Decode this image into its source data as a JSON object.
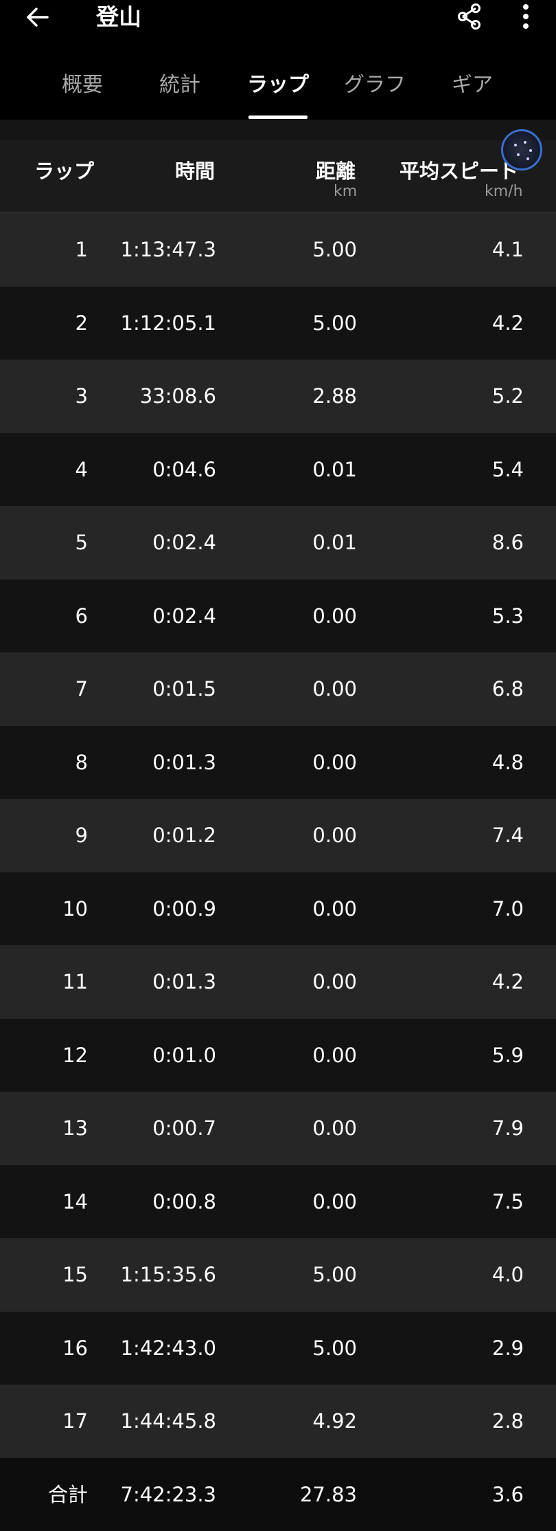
{
  "header": {
    "title": "登山",
    "icons": {
      "back": "arrow-left-icon",
      "share": "share-icon",
      "more": "more-vert-icon"
    }
  },
  "tabs": [
    {
      "label": "概要"
    },
    {
      "label": "統計"
    },
    {
      "label": "ラップ",
      "active": true
    },
    {
      "label": "グラフ"
    },
    {
      "label": "ギア"
    }
  ],
  "table": {
    "columns": {
      "lap": "ラップ",
      "time": "時間",
      "distance": "距離",
      "distance_unit": "km",
      "speed": "平均スピード",
      "speed_unit": "km/h"
    },
    "rows": [
      {
        "lap": "1",
        "time": "1:13:47.3",
        "distance": "5.00",
        "speed": "4.1"
      },
      {
        "lap": "2",
        "time": "1:12:05.1",
        "distance": "5.00",
        "speed": "4.2"
      },
      {
        "lap": "3",
        "time": "33:08.6",
        "distance": "2.88",
        "speed": "5.2"
      },
      {
        "lap": "4",
        "time": "0:04.6",
        "distance": "0.01",
        "speed": "5.4"
      },
      {
        "lap": "5",
        "time": "0:02.4",
        "distance": "0.01",
        "speed": "8.6"
      },
      {
        "lap": "6",
        "time": "0:02.4",
        "distance": "0.00",
        "speed": "5.3"
      },
      {
        "lap": "7",
        "time": "0:01.5",
        "distance": "0.00",
        "speed": "6.8"
      },
      {
        "lap": "8",
        "time": "0:01.3",
        "distance": "0.00",
        "speed": "4.8"
      },
      {
        "lap": "9",
        "time": "0:01.2",
        "distance": "0.00",
        "speed": "7.4"
      },
      {
        "lap": "10",
        "time": "0:00.9",
        "distance": "0.00",
        "speed": "7.0"
      },
      {
        "lap": "11",
        "time": "0:01.3",
        "distance": "0.00",
        "speed": "4.2"
      },
      {
        "lap": "12",
        "time": "0:01.0",
        "distance": "0.00",
        "speed": "5.9"
      },
      {
        "lap": "13",
        "time": "0:00.7",
        "distance": "0.00",
        "speed": "7.9"
      },
      {
        "lap": "14",
        "time": "0:00.8",
        "distance": "0.00",
        "speed": "7.5"
      },
      {
        "lap": "15",
        "time": "1:15:35.6",
        "distance": "5.00",
        "speed": "4.0"
      },
      {
        "lap": "16",
        "time": "1:42:43.0",
        "distance": "5.00",
        "speed": "2.9"
      },
      {
        "lap": "17",
        "time": "1:44:45.8",
        "distance": "4.92",
        "speed": "2.8"
      }
    ],
    "total": {
      "lap": "合計",
      "time": "7:42:23.3",
      "distance": "27.83",
      "speed": "3.6"
    }
  }
}
